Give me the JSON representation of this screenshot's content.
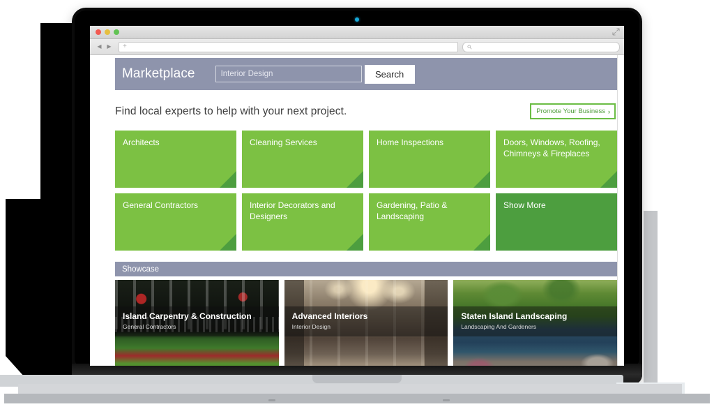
{
  "browser": {
    "traffic_lights": [
      "close",
      "minimize",
      "maximize"
    ],
    "url_value": "",
    "url_placeholder": "",
    "search_value": "",
    "search_placeholder": ""
  },
  "site": {
    "header": {
      "title": "Marketplace",
      "search_value": "Interior Design",
      "search_placeholder": "Interior Design",
      "search_button": "Search"
    },
    "tagline": "Find local experts to help with your next project.",
    "promote_button": {
      "label": "Promote Your Business",
      "chevron": "›"
    },
    "categories": [
      {
        "label": "Architects",
        "style": "light"
      },
      {
        "label": "Cleaning Services",
        "style": "light"
      },
      {
        "label": "Home Inspections",
        "style": "light"
      },
      {
        "label": "Doors, Windows, Roofing, Chimneys & Fireplaces",
        "style": "light"
      },
      {
        "label": "General Contractors",
        "style": "light"
      },
      {
        "label": "Interior Decorators and Designers",
        "style": "light"
      },
      {
        "label": "Gardening, Patio & Landscaping",
        "style": "light"
      },
      {
        "label": "Show More",
        "style": "dark"
      }
    ],
    "showcase": {
      "title": "Showcase",
      "cards": [
        {
          "name": "Island Carpentry & Construction",
          "category": "General Contractors",
          "photo": "porch-with-flowers"
        },
        {
          "name": "Advanced Interiors",
          "category": "Interior Design",
          "photo": "bathroom-interior"
        },
        {
          "name": "Staten Island Landscaping",
          "category": "Landscaping And Gardeners",
          "photo": "pond-landscape"
        }
      ]
    }
  },
  "colors": {
    "header_bar": "#8e94ac",
    "tile_green": "#7cc143",
    "tile_green_dark": "#4d9e3f",
    "promote_border": "#6bbd45",
    "promote_text": "#4e9c3a",
    "camera_led": "#17a8d8"
  }
}
